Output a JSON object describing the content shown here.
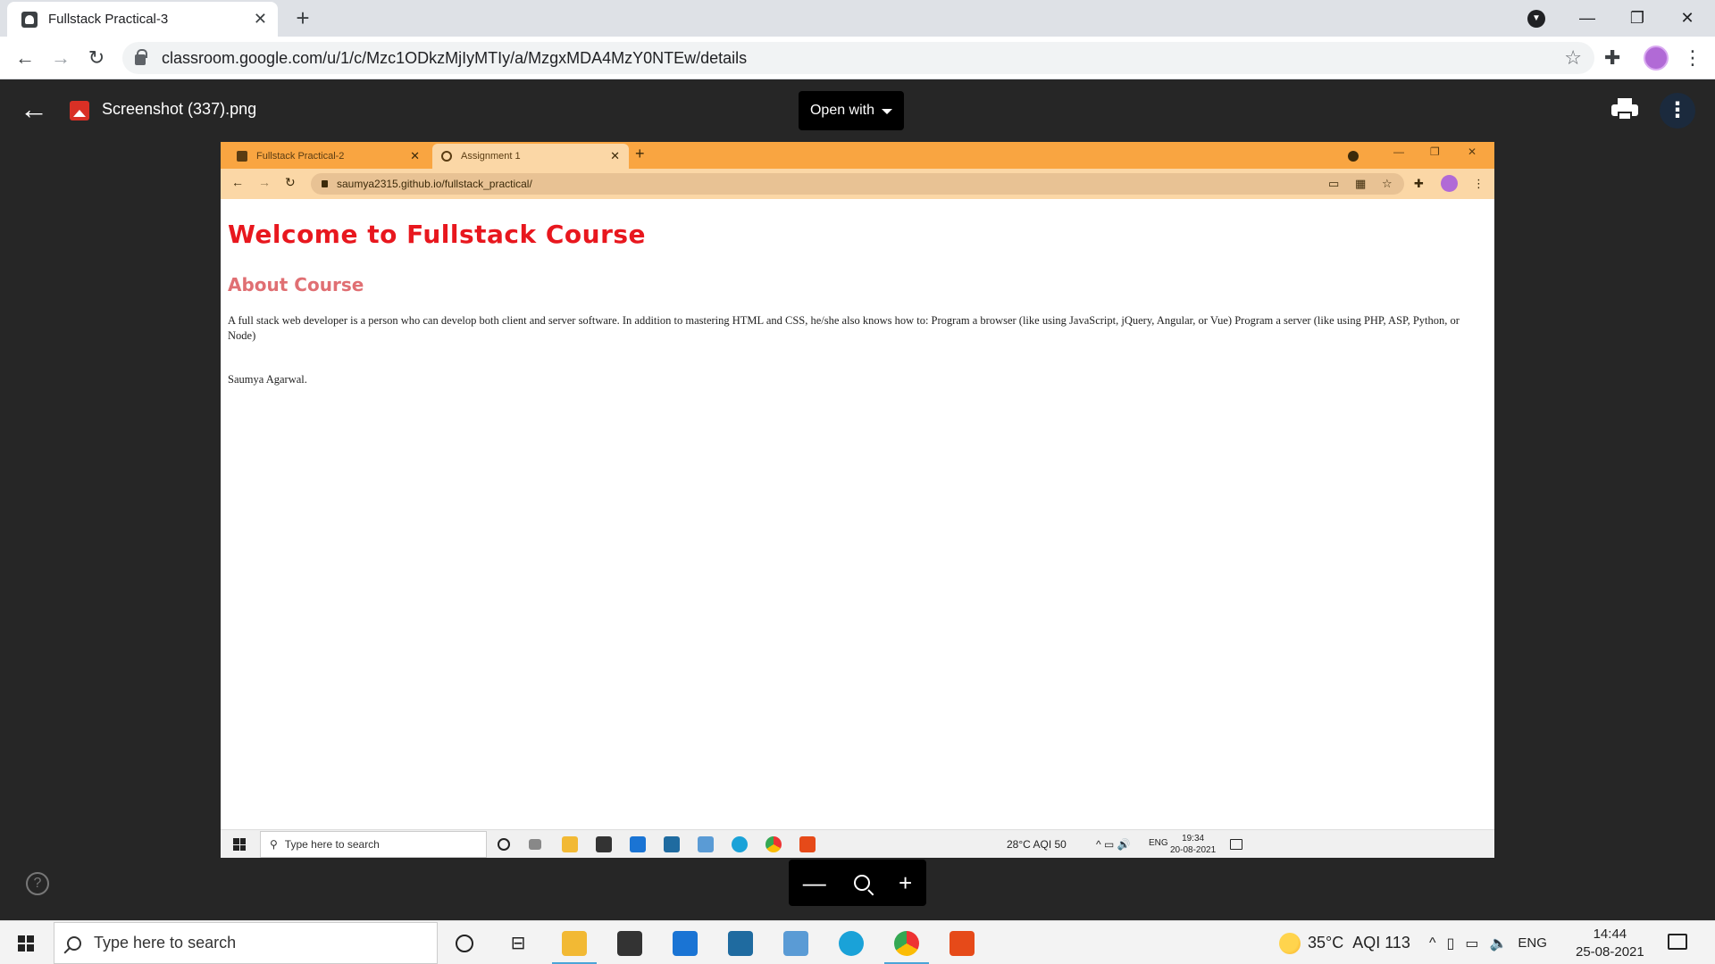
{
  "browser": {
    "tab_title": "Fullstack Practical-3",
    "url": "classroom.google.com/u/1/c/Mzc1ODkzMjIyMTIy/a/MzgxMDA4MzY0NTEw/details"
  },
  "viewer": {
    "file_title": "Screenshot (337).png",
    "open_with_label": "Open with"
  },
  "shot": {
    "tabs": [
      {
        "label": "Fullstack Practical-2"
      },
      {
        "label": "Assignment 1"
      }
    ],
    "url": "saumya2315.github.io/fullstack_practical/",
    "page": {
      "heading": "Welcome to Fullstack Course",
      "subheading": "About Course",
      "description": "A full stack web developer is a person who can develop both client and server software. In addition to mastering HTML and CSS, he/she also knows how to: Program a browser (like using JavaScript, jQuery, Angular, or Vue) Program a server (like using PHP, ASP, Python, or Node)",
      "author": "Saumya Agarwal."
    },
    "taskbar": {
      "search_placeholder": "Type here to search",
      "weather": "28°C",
      "aqi": "AQI 50",
      "lang": "ENG",
      "time": "19:34",
      "date": "20-08-2021"
    }
  },
  "taskbar": {
    "search_placeholder": "Type here to search",
    "weather": "35°C",
    "aqi": "AQI 113",
    "lang": "ENG",
    "time": "14:44",
    "date": "25-08-2021"
  },
  "colors": {
    "heading": "#e8171e",
    "subheading": "#e06f73",
    "inner_tabbar": "#f9a541",
    "inner_toolbar": "#fbd7a6"
  }
}
